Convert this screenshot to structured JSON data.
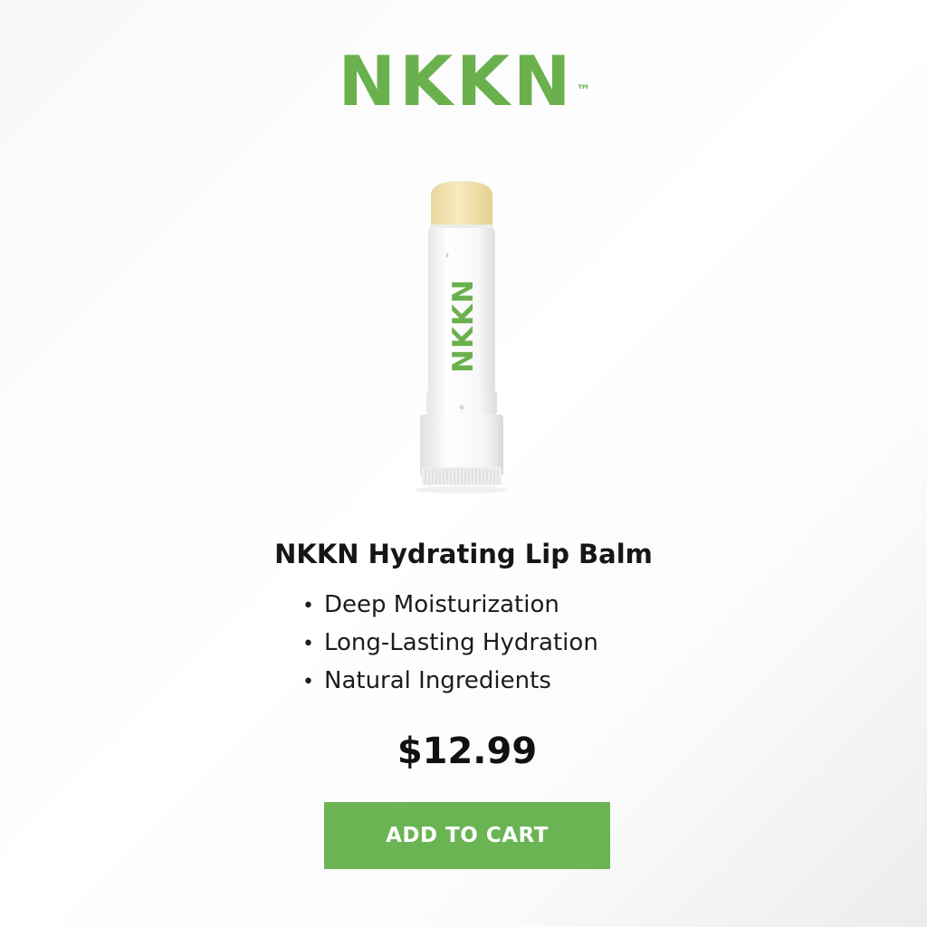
{
  "brand": {
    "name": "NKKN",
    "trademark": "™",
    "color": "#6ab14d"
  },
  "product": {
    "image_label": "NKKN",
    "image_trademark": "™",
    "title": "NKKN Hydrating Lip Balm",
    "features": [
      "Deep Moisturization",
      "Long-Lasting Hydration",
      "Natural Ingredients"
    ],
    "bullet": "•",
    "price": "$12.99"
  },
  "actions": {
    "add_to_cart_label": "ADD TO CART",
    "button_color": "#6ab454"
  }
}
